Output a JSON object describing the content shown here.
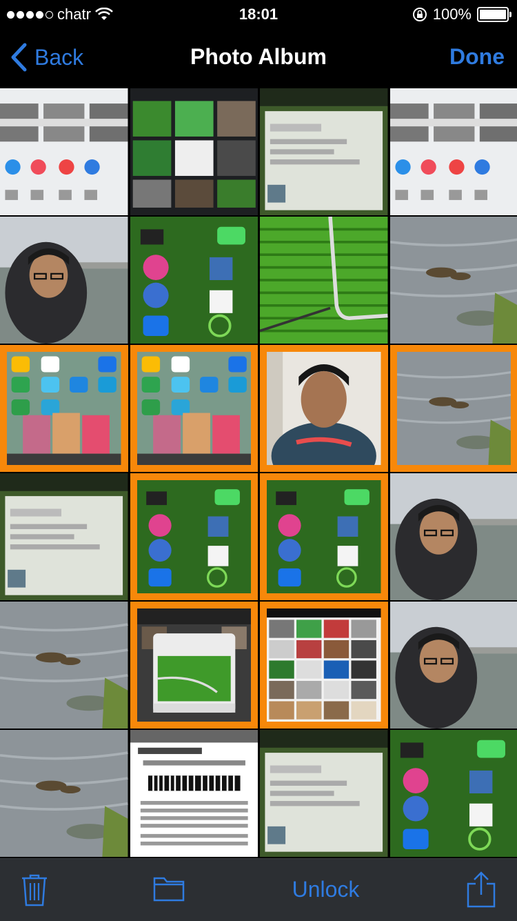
{
  "status_bar": {
    "carrier": "chatr",
    "time": "18:01",
    "battery": "100%",
    "signal_bars": 4
  },
  "nav": {
    "back_label": "Back",
    "title": "Photo Album",
    "done_label": "Done"
  },
  "photos": [
    {
      "kind": "share-sheet",
      "selected": false
    },
    {
      "kind": "photo-grid",
      "selected": false
    },
    {
      "kind": "library-renewal",
      "selected": false
    },
    {
      "kind": "share-sheet",
      "selected": false
    },
    {
      "kind": "selfie-river",
      "selected": false
    },
    {
      "kind": "app-icons",
      "selected": false
    },
    {
      "kind": "green-mat",
      "selected": false
    },
    {
      "kind": "river-ducks",
      "selected": false
    },
    {
      "kind": "home-screen",
      "selected": true
    },
    {
      "kind": "home-screen",
      "selected": true
    },
    {
      "kind": "portrait",
      "selected": true
    },
    {
      "kind": "river-ducks",
      "selected": true
    },
    {
      "kind": "library-renewal",
      "selected": false
    },
    {
      "kind": "app-icons",
      "selected": true
    },
    {
      "kind": "app-icons",
      "selected": true
    },
    {
      "kind": "selfie-river",
      "selected": false
    },
    {
      "kind": "river-ducks",
      "selected": false
    },
    {
      "kind": "delete-dialog",
      "selected": true
    },
    {
      "kind": "album-grid",
      "selected": true
    },
    {
      "kind": "selfie-river",
      "selected": false
    },
    {
      "kind": "river-ducks",
      "selected": false
    },
    {
      "kind": "ticket",
      "selected": false
    },
    {
      "kind": "library-renewal",
      "selected": false
    },
    {
      "kind": "app-icons",
      "selected": false
    }
  ],
  "toolbar": {
    "trash_icon": "trash-icon",
    "folder_icon": "folder-icon",
    "unlock_label": "Unlock",
    "share_icon": "share-icon"
  },
  "colors": {
    "accent": "#2f7be0",
    "selection": "#f7880a",
    "toolbar_bg": "#2c2f33"
  }
}
